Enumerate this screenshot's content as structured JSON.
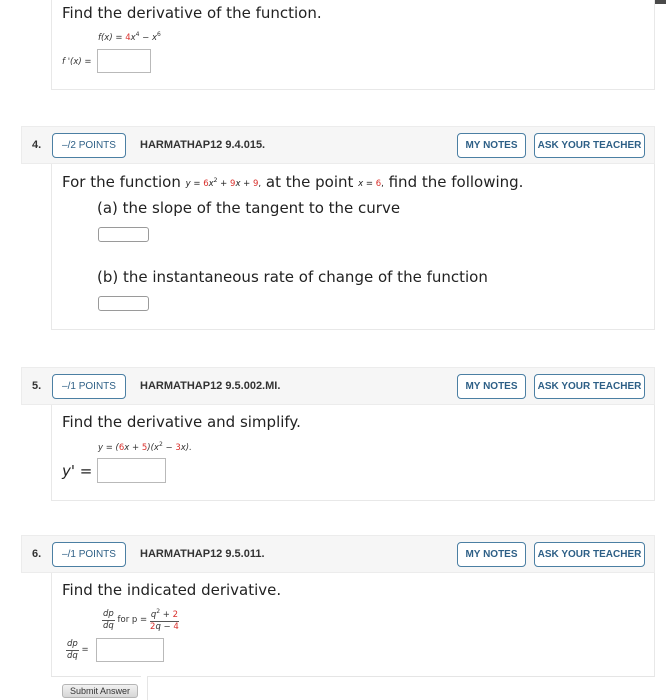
{
  "q3": {
    "prompt": "Find the derivative of the function.",
    "function_lhs": "f(x) = ",
    "function_coef": "4",
    "function_term1": "x",
    "function_exp1": "4",
    "function_minus": " − x",
    "function_exp2": "6",
    "answer_label": "f '(x) = ",
    "answer_value": ""
  },
  "q4": {
    "number": "4.",
    "points": "–/2 POINTS",
    "code": "HARMATHAP12 9.4.015.",
    "my_notes": "MY NOTES",
    "ask_teacher": "ASK YOUR TEACHER",
    "prompt_start": "For the function ",
    "eq_y": "y = ",
    "eq_c1": "6",
    "eq_x2": "x",
    "eq_exp": "2",
    "eq_plus1": " + ",
    "eq_c2": "9",
    "eq_x": "x + ",
    "eq_c3": "9",
    "eq_comma": ",",
    "prompt_mid": " at the point ",
    "pt_x": "x = ",
    "pt_val": "6",
    "pt_comma": ",",
    "prompt_end": " find the following.",
    "part_a": "(a) the slope of the tangent to the curve",
    "part_b": "(b) the instantaneous rate of change of the function",
    "answer_a": "",
    "answer_b": ""
  },
  "q5": {
    "number": "5.",
    "points": "–/1 POINTS",
    "code": "HARMATHAP12 9.5.002.MI.",
    "my_notes": "MY NOTES",
    "ask_teacher": "ASK YOUR TEACHER",
    "prompt": "Find the derivative and simplify.",
    "eq_start": "y = (",
    "eq_c1": "6",
    "eq_p1": "x + ",
    "eq_c2": "5",
    "eq_p2": ")(x",
    "eq_exp": "2",
    "eq_p3": " − ",
    "eq_c3": "3",
    "eq_p4": "x).",
    "answer_label": "y' = ",
    "answer_value": ""
  },
  "q6": {
    "number": "6.",
    "points": "–/1 POINTS",
    "code": "HARMATHAP12 9.5.011.",
    "my_notes": "MY NOTES",
    "ask_teacher": "ASK YOUR TEACHER",
    "prompt": "Find the indicated derivative.",
    "d_num": "dp",
    "d_den": "dq",
    "for_text": " for p = ",
    "frac_num_q": "q",
    "frac_num_exp": "2",
    "frac_num_plus": " + ",
    "frac_num_c": "2",
    "frac_den_c": "2",
    "frac_den_rest": "q − ",
    "frac_den_c2": "4",
    "answer_eq": " =",
    "answer_value": "",
    "submit": "Submit Answer"
  }
}
